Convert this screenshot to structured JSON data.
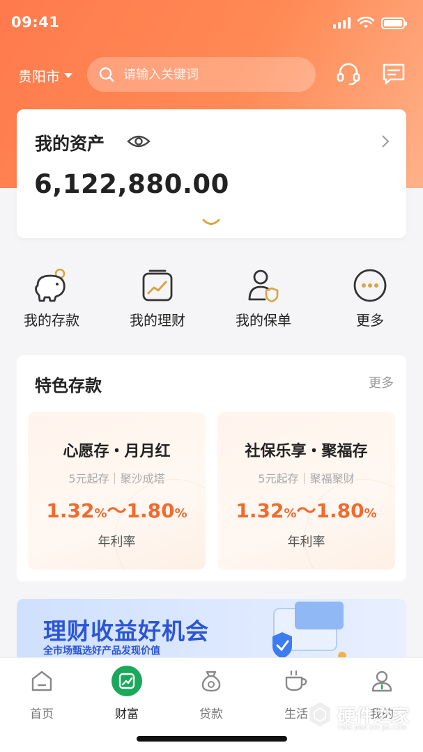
{
  "status_bar": {
    "time": "09:41"
  },
  "header": {
    "city": "贵阳市",
    "search_placeholder": "请输入关键词",
    "icons": [
      "headset-icon",
      "message-icon"
    ]
  },
  "assets": {
    "title": "我的资产",
    "value": "6,122,880.00"
  },
  "shortcuts": [
    {
      "label": "我的存款",
      "icon": "piggy-bank-icon"
    },
    {
      "label": "我的理财",
      "icon": "wealth-chart-icon"
    },
    {
      "label": "我的保单",
      "icon": "insurance-user-icon"
    },
    {
      "label": "更多",
      "icon": "more-icon"
    }
  ],
  "featured": {
    "title": "特色存款",
    "more": "更多",
    "products": [
      {
        "name": "心愿存・月月红",
        "sub": "5元起存｜聚沙成塔",
        "rate_low": "1.32",
        "rate_high": "1.80",
        "pct": "%",
        "tilde": "～",
        "rate_label": "年利率"
      },
      {
        "name": "社保乐享・聚福存",
        "sub": "5元起存｜聚福聚财",
        "rate_low": "1.32",
        "rate_high": "1.80",
        "pct": "%",
        "tilde": "～",
        "rate_label": "年利率"
      }
    ]
  },
  "banner": {
    "title": "理财收益好机会",
    "subtitle": "全市场甄选好产品发现价值"
  },
  "tabbar": [
    {
      "label": "首页",
      "icon": "home-icon"
    },
    {
      "label": "财富",
      "icon": "wealth-icon",
      "active": true
    },
    {
      "label": "贷款",
      "icon": "loan-bag-icon"
    },
    {
      "label": "生活",
      "icon": "coffee-cup-icon"
    },
    {
      "label": "我的",
      "icon": "user-icon"
    }
  ],
  "watermark": {
    "text": "硬件之家",
    "sub": "YING JIAN ZHI JIA.COM"
  },
  "colors": {
    "accent": "#ff7a4d",
    "rate": "#f26a2e",
    "gold": "#d9a441",
    "active_tab": "#1aa85a"
  }
}
